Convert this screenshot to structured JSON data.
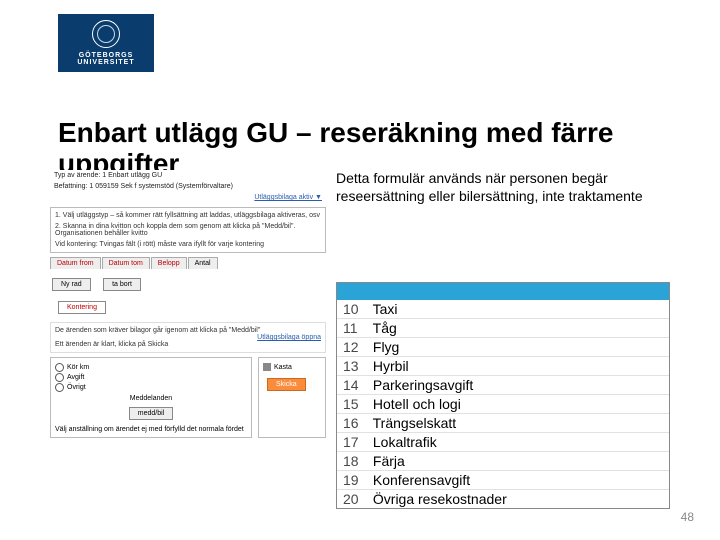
{
  "logo": {
    "line1": "GÖTEBORGS",
    "line2": "UNIVERSITET"
  },
  "title": "Enbart utlägg GU – reseräkning med färre uppgifter",
  "body": "Detta formulär används när personen begär reseersättning eller bilersättning, inte traktamente",
  "form": {
    "topline": "Typ av ärende: 1 Enbart utlägg GU",
    "befattning": "Befattning: 1   059159 Sek f systemstöd (Systemförvaltare)",
    "bilagehdr": "Utläggsbilaga aktiv ▼",
    "note1": "1. Välj utläggstyp – så kommer rätt fyllsättning att laddas, utläggsbilaga aktiveras, osv",
    "note2": "2. Skanna in dina kvitton och koppla dem som genom att klicka på \"Medd/bil\". Organisationen behåller kvitto",
    "kontering": "Vid kontering: Tvingas fält (i rött) måste vara ifyllt för varje kontering",
    "tabs": [
      "Datum from",
      "Datum tom",
      "Belopp",
      "Antal"
    ],
    "btn_new": "Ny rad",
    "btn_remove": "ta bort",
    "kontering_h": "Kontering",
    "note3": "De ärenden som kräver bilagor går igenom att klicka på \"Medd/bil\"",
    "link_bilage": "Utläggsbilaga öppna",
    "note4": "Ett ärenden är klart, klicka på Skicka",
    "msg_h": "Meddelanden",
    "attach": "medd/bil",
    "btn_kasta": "Kasta",
    "btn_skicka": "Skicka",
    "radios": [
      "Kör km",
      "Avgift",
      "Övrigt"
    ],
    "footer": "Välj anställning om ärendet ej med förfylld det normala fördet"
  },
  "costs": [
    {
      "code": "10",
      "label": "Taxi"
    },
    {
      "code": "11",
      "label": "Tåg"
    },
    {
      "code": "12",
      "label": "Flyg"
    },
    {
      "code": "13",
      "label": "Hyrbil"
    },
    {
      "code": "14",
      "label": "Parkeringsavgift"
    },
    {
      "code": "15",
      "label": "Hotell och logi"
    },
    {
      "code": "16",
      "label": "Trängselskatt"
    },
    {
      "code": "17",
      "label": "Lokaltrafik"
    },
    {
      "code": "18",
      "label": "Färja"
    },
    {
      "code": "19",
      "label": "Konferensavgift"
    },
    {
      "code": "20",
      "label": "Övriga resekostnader"
    }
  ],
  "page": "48"
}
